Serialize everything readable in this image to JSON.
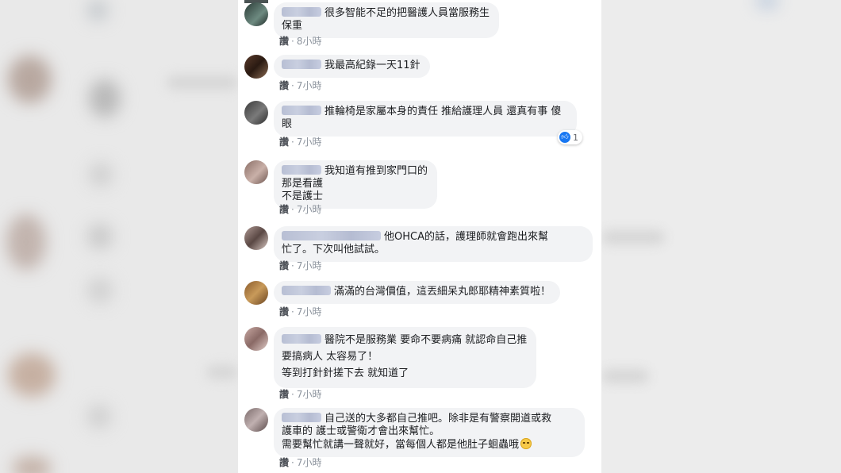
{
  "comments": [
    {
      "lines": [
        "很多智能不足的把醫護人員當服務生",
        "保重"
      ],
      "like_label": "讚",
      "time": "8小時"
    },
    {
      "lines": [
        "我最高紀錄一天11針"
      ],
      "like_label": "讚",
      "time": "7小時"
    },
    {
      "lines": [
        "推輪椅是家屬本身的責任 推給護理人員 還真有事 傻",
        "眼"
      ],
      "like_label": "讚",
      "time": "7小時",
      "reaction_count": "1"
    },
    {
      "lines": [
        "我知道有推到家門口的",
        "那是看護",
        "不是護士"
      ],
      "like_label": "讚",
      "time": "7小時"
    },
    {
      "lines": [
        "他OHCA的話，護理師就會跑出來幫",
        "忙了。下次叫他試試。"
      ],
      "like_label": "讚",
      "time": "7小時"
    },
    {
      "lines": [
        "滿滿的台灣價值，這丟細呆丸郎耶精神素質啦！"
      ],
      "like_label": "讚",
      "time": "7小時"
    },
    {
      "lines": [
        "醫院不是服務業 要命不要病痛 就認命自己推",
        "要搞病人 太容易了！",
        "等到打針針搓下去 就知道了"
      ],
      "like_label": "讚",
      "time": "7小時"
    },
    {
      "lines": [
        "自己送的大多都自己推吧。除非是有警察開道或救",
        "護車的 護士或警衛才會出來幫忙。",
        "需要幫忙就講一聲就好，當每個人都是他肚子蛔蟲哦"
      ],
      "like_label": "讚",
      "time": "7小時"
    }
  ],
  "action_separator": "·",
  "colors": {
    "bubble": "#f2f3f5",
    "text": "#1c1e21",
    "meta": "#8d949e",
    "reaction_blue": "#1877f2"
  },
  "icons": {
    "reaction": "like-thumb-icon",
    "emoji": "smiling-face-icon"
  }
}
